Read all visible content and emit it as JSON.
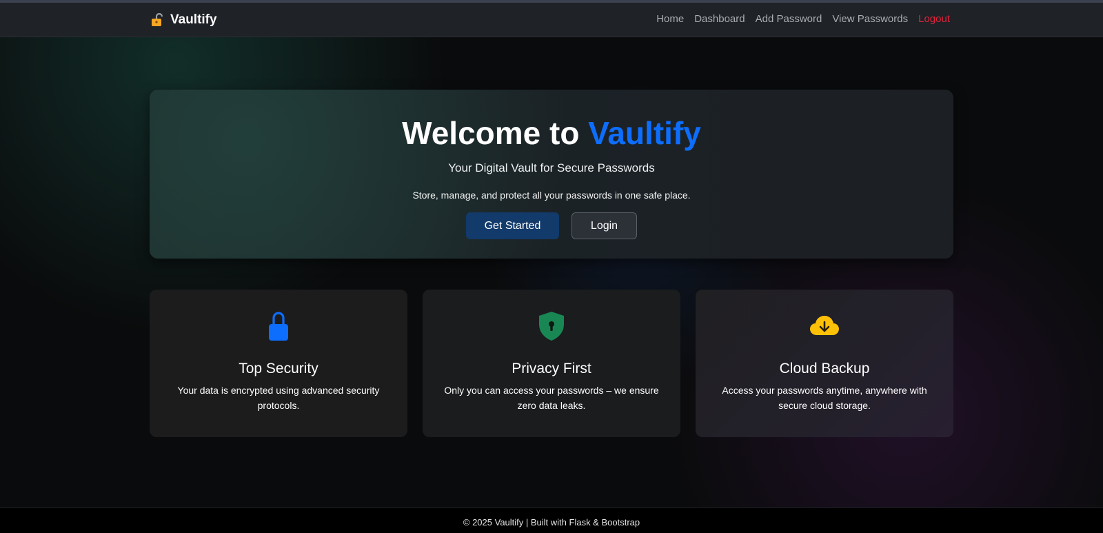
{
  "navbar": {
    "brand": "Vaultify",
    "brand_icon": "unlocked-padlock-icon",
    "links": [
      {
        "label": "Home"
      },
      {
        "label": "Dashboard"
      },
      {
        "label": "Add Password"
      },
      {
        "label": "View Passwords"
      },
      {
        "label": "Logout",
        "color": "#e0233c"
      }
    ]
  },
  "hero": {
    "title_prefix": "Welcome to",
    "title_accent": "Vaultify",
    "accent_color": "#0d6efd",
    "subtitle": "Your Digital Vault for Secure Passwords",
    "description": "Store, manage, and protect all your passwords in one safe place.",
    "primary_button": "Get Started",
    "secondary_button": "Login"
  },
  "features": [
    {
      "icon": "lock-icon",
      "icon_color": "#0d6efd",
      "title": "Top Security",
      "text": "Your data is encrypted using advanced security protocols."
    },
    {
      "icon": "shield-lock-icon",
      "icon_color": "#198754",
      "title": "Privacy First",
      "text": "Only you can access your passwords – we ensure zero data leaks."
    },
    {
      "icon": "cloud-download-icon",
      "icon_color": "#ffc107",
      "title": "Cloud Backup",
      "text": "Access your passwords anytime, anywhere with secure cloud storage."
    }
  ],
  "footer": {
    "text": "© 2025 Vaultify | Built with Flask & Bootstrap"
  }
}
